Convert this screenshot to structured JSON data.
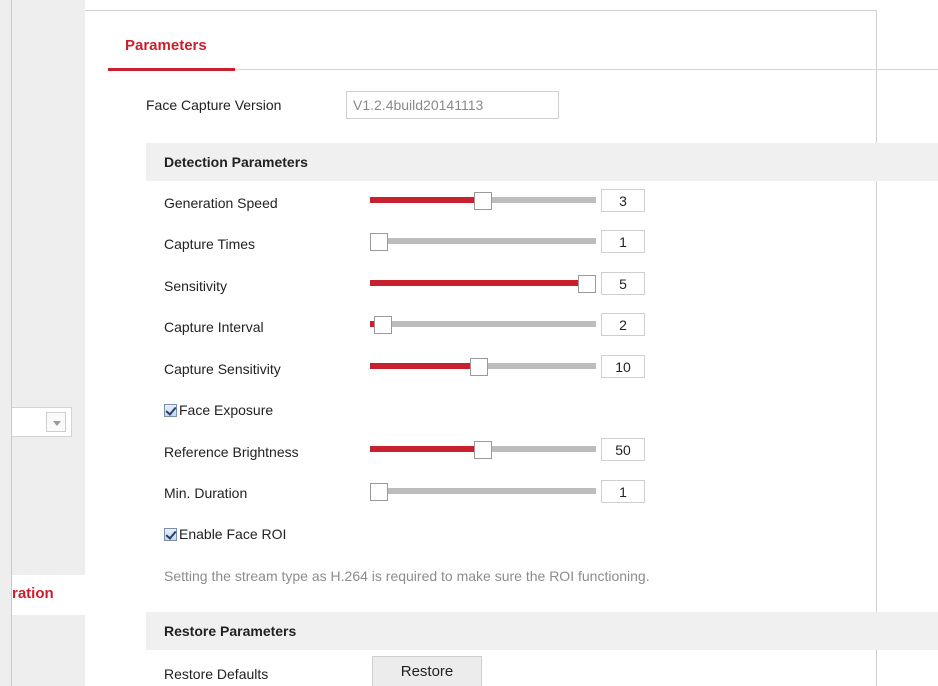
{
  "sidebar": {
    "active_item_label": "ration"
  },
  "tabs": [
    {
      "label": "Parameters",
      "active": true
    }
  ],
  "face_capture_version": {
    "label": "Face Capture Version",
    "value": "V1.2.4build20141113"
  },
  "detection": {
    "title": "Detection Parameters",
    "generation_speed": {
      "label": "Generation Speed",
      "value": "3",
      "level": 0.5
    },
    "capture_times": {
      "label": "Capture Times",
      "value": "1",
      "level": 0.0
    },
    "sensitivity": {
      "label": "Sensitivity",
      "value": "5",
      "level": 1.0
    },
    "capture_interval": {
      "label": "Capture Interval",
      "value": "2",
      "level": 0.02
    },
    "capture_sensitivity": {
      "label": "Capture Sensitivity",
      "value": "10",
      "level": 0.48
    },
    "face_exposure": {
      "label": "Face Exposure",
      "checked": true
    },
    "reference_brightness": {
      "label": "Reference Brightness",
      "value": "50",
      "level": 0.5
    },
    "min_duration": {
      "label": "Min. Duration",
      "value": "1",
      "level": 0.0
    },
    "enable_face_roi": {
      "label": "Enable Face ROI",
      "checked": true
    },
    "roi_hint": "Setting the stream type as H.264 is required to make sure the ROI functioning."
  },
  "restore": {
    "title": "Restore Parameters",
    "defaults_label": "Restore Defaults",
    "button_label": "Restore"
  },
  "colors": {
    "accent": "#c8202e",
    "track": "#bdbdbd",
    "section_bg": "#f0f0f0"
  }
}
